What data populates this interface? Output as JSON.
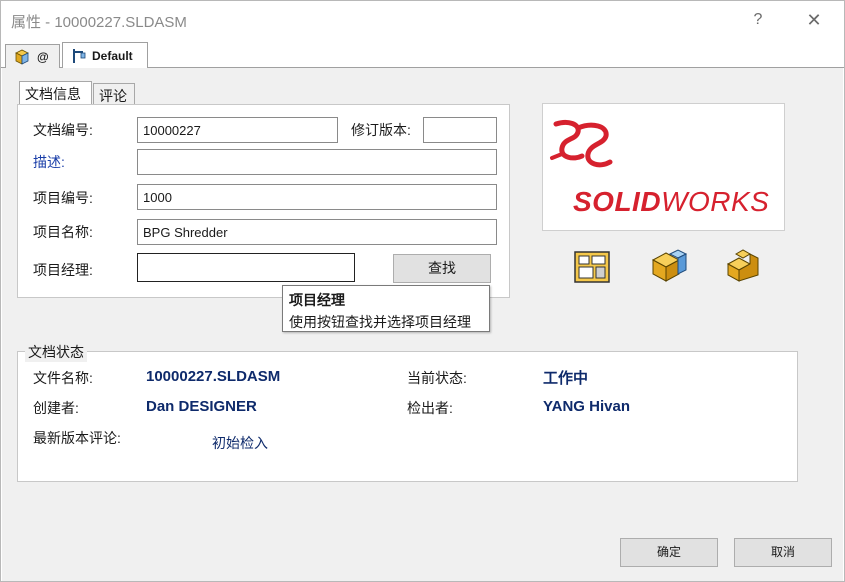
{
  "window": {
    "title": "属性 - 10000227.SLDASM",
    "help": "?",
    "close": "✕"
  },
  "config_tabs": [
    {
      "label": "@",
      "icon": "assembly-icon"
    },
    {
      "label": "Default",
      "icon": "configuration-icon"
    }
  ],
  "inner_tabs": [
    {
      "label": "文档信息"
    },
    {
      "label": "评论"
    }
  ],
  "doc_info": {
    "doc_number_label": "文档编号:",
    "doc_number_value": "10000227",
    "revision_label": "修订版本:",
    "revision_value": "",
    "description_label": "描述:",
    "description_value": "",
    "project_number_label": "项目编号:",
    "project_number_value": "1000",
    "project_name_label": "项目名称:",
    "project_name_value": "BPG Shredder",
    "project_manager_label": "项目经理:",
    "project_manager_value": "",
    "search_button": "查找"
  },
  "tooltip": {
    "title": "项目经理",
    "body": "使用按钮查找并选择项目经理"
  },
  "logo": {
    "solid": "SOLID",
    "works": "WORKS",
    "brand_color": "#d6212e"
  },
  "right_icons": [
    "drawing-icon",
    "assembly-icon",
    "part-icon"
  ],
  "doc_status": {
    "title": "文档状态",
    "file_name_label": "文件名称:",
    "file_name_value": "10000227.SLDASM",
    "creator_label": "创建者:",
    "creator_value": "Dan DESIGNER",
    "current_state_label": "当前状态:",
    "current_state_value": "工作中",
    "checked_out_label": "检出者:",
    "checked_out_value": "YANG Hivan",
    "latest_comment_label": "最新版本评论:",
    "latest_comment_value": "初始检入"
  },
  "buttons": {
    "ok": "确定",
    "cancel": "取消"
  }
}
